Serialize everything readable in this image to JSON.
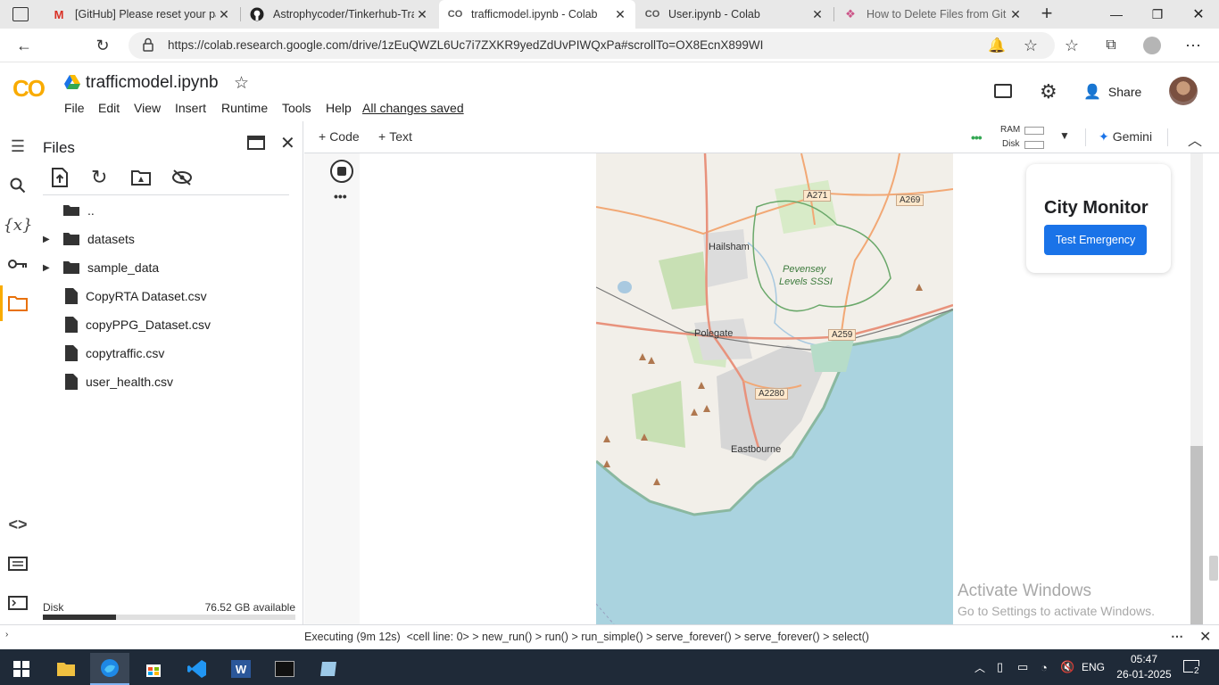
{
  "browser": {
    "tabs": [
      {
        "title": "[GitHub] Please reset your pa",
        "icon": "gmail-icon",
        "active": false
      },
      {
        "title": "Astrophycoder/Tinkerhub-Tra",
        "icon": "github-icon",
        "active": false
      },
      {
        "title": "trafficmodel.ipynb - Colab",
        "icon": "colab-icon",
        "active": true
      },
      {
        "title": "User.ipynb - Colab",
        "icon": "colab-icon",
        "active": false
      },
      {
        "title": "How to Delete Files from Git",
        "icon": "site-icon",
        "active": false
      }
    ],
    "url": "https://colab.research.google.com/drive/1zEuQWZL6Uc7i7ZXKR9yedZdUvPIWQxPa#scrollTo=OX8EcnX899WI"
  },
  "colab": {
    "logo": "CO",
    "notebook_name": "trafficmodel.ipynb",
    "menu": [
      "File",
      "Edit",
      "View",
      "Insert",
      "Runtime",
      "Tools",
      "Help"
    ],
    "save_status": "All changes saved",
    "share_label": "Share"
  },
  "files_panel": {
    "title": "Files",
    "items": [
      {
        "name": "..",
        "type": "folder-up"
      },
      {
        "name": "datasets",
        "type": "folder"
      },
      {
        "name": "sample_data",
        "type": "folder"
      },
      {
        "name": "CopyRTA Dataset.csv",
        "type": "file"
      },
      {
        "name": "copyPPG_Dataset.csv",
        "type": "file"
      },
      {
        "name": "copytraffic.csv",
        "type": "file"
      },
      {
        "name": "user_health.csv",
        "type": "file"
      }
    ],
    "disk_label": "Disk",
    "disk_available": "76.52 GB available",
    "disk_usage_fraction": 0.29
  },
  "toolbar": {
    "code_label": "Code",
    "text_label": "Text",
    "ram_label": "RAM",
    "disk_label": "Disk",
    "gemini_label": "Gemini"
  },
  "map": {
    "places": [
      "Hailsham",
      "Polegate",
      "Eastbourne"
    ],
    "area_label_1": "Pevensey",
    "area_label_2": "Levels SSSI",
    "roads": [
      "A271",
      "A269",
      "A259",
      "A2280"
    ]
  },
  "city_monitor": {
    "title": "City Monitor",
    "button_label": "Test Emergency"
  },
  "watermark": {
    "line1": "Activate Windows",
    "line2": "Go to Settings to activate Windows."
  },
  "status": {
    "text": "Executing (9m 12s)  <cell line: 0> > new_run() > run() > run_simple() > serve_forever() > serve_forever() > select()"
  },
  "taskbar": {
    "language": "ENG",
    "time": "05:47",
    "date": "26-01-2025",
    "notifications": "2"
  },
  "colors": {
    "accent_blue": "#1a73e8",
    "colab_orange": "#f9ab00",
    "water": "#aad3df",
    "taskbar": "#1f2a38"
  }
}
